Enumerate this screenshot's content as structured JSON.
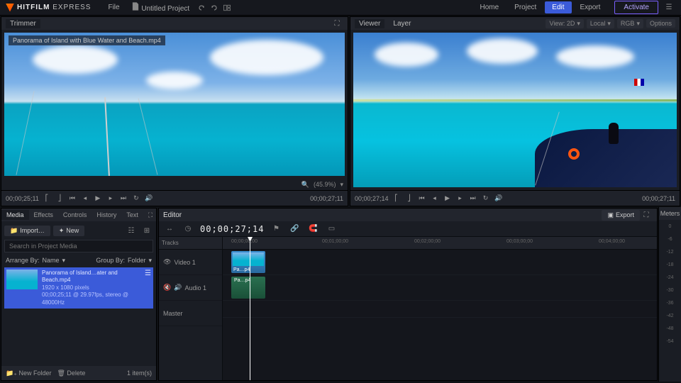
{
  "app": {
    "name_bold": "HITFILM",
    "name_thin": "EXPRESS"
  },
  "menu": {
    "file": "File",
    "project": "Untitled Project"
  },
  "nav": {
    "home": "Home",
    "project": "Project",
    "edit": "Edit",
    "export": "Export",
    "activate": "Activate"
  },
  "trimmer": {
    "title": "Trimmer",
    "clip_name": "Panorama of Island with Blue Water and Beach.mp4",
    "zoom": "(45.9%)",
    "time_left": "00;00;25;11",
    "time_right": "00;00;27;11"
  },
  "viewer": {
    "title": "Viewer",
    "tab_layer": "Layer",
    "view_mode": "View: 2D",
    "space": "Local",
    "channels": "RGB",
    "options": "Options",
    "time_left": "00;00;27;14",
    "time_right": "00;00;27;11"
  },
  "media": {
    "tabs": {
      "media": "Media",
      "effects": "Effects",
      "controls": "Controls",
      "history": "History",
      "text": "Text"
    },
    "import": "Import…",
    "new": "New",
    "search_placeholder": "Search in Project Media",
    "arrange_label": "Arrange By:",
    "arrange_value": "Name",
    "group_label": "Group By:",
    "group_value": "Folder",
    "item": {
      "name": "Panorama of Island…ater and Beach.mp4",
      "dims": "1920 x 1080 pixels",
      "meta": "00;00;25;11 @ 29.97fps, stereo @ 48000Hz"
    },
    "footer_new": "New Folder",
    "footer_del": "Delete",
    "count": "1 item(s)"
  },
  "editor": {
    "title": "Editor",
    "timecode": "00;00;27;14",
    "tracks_label": "Tracks",
    "export": "Export",
    "video_track": "Video 1",
    "audio_track": "Audio 1",
    "master_track": "Master",
    "clip_abbr": "Pa…p4",
    "ruler": [
      "00;00;00;00",
      "00;01;00;00",
      "00;02;00;00",
      "00;03;00;00",
      "00;04;00;00"
    ]
  },
  "meters": {
    "title": "Meters",
    "marks": [
      "0",
      "-6",
      "-12",
      "-18",
      "-24",
      "-30",
      "-36",
      "-42",
      "-48",
      "-54"
    ]
  }
}
